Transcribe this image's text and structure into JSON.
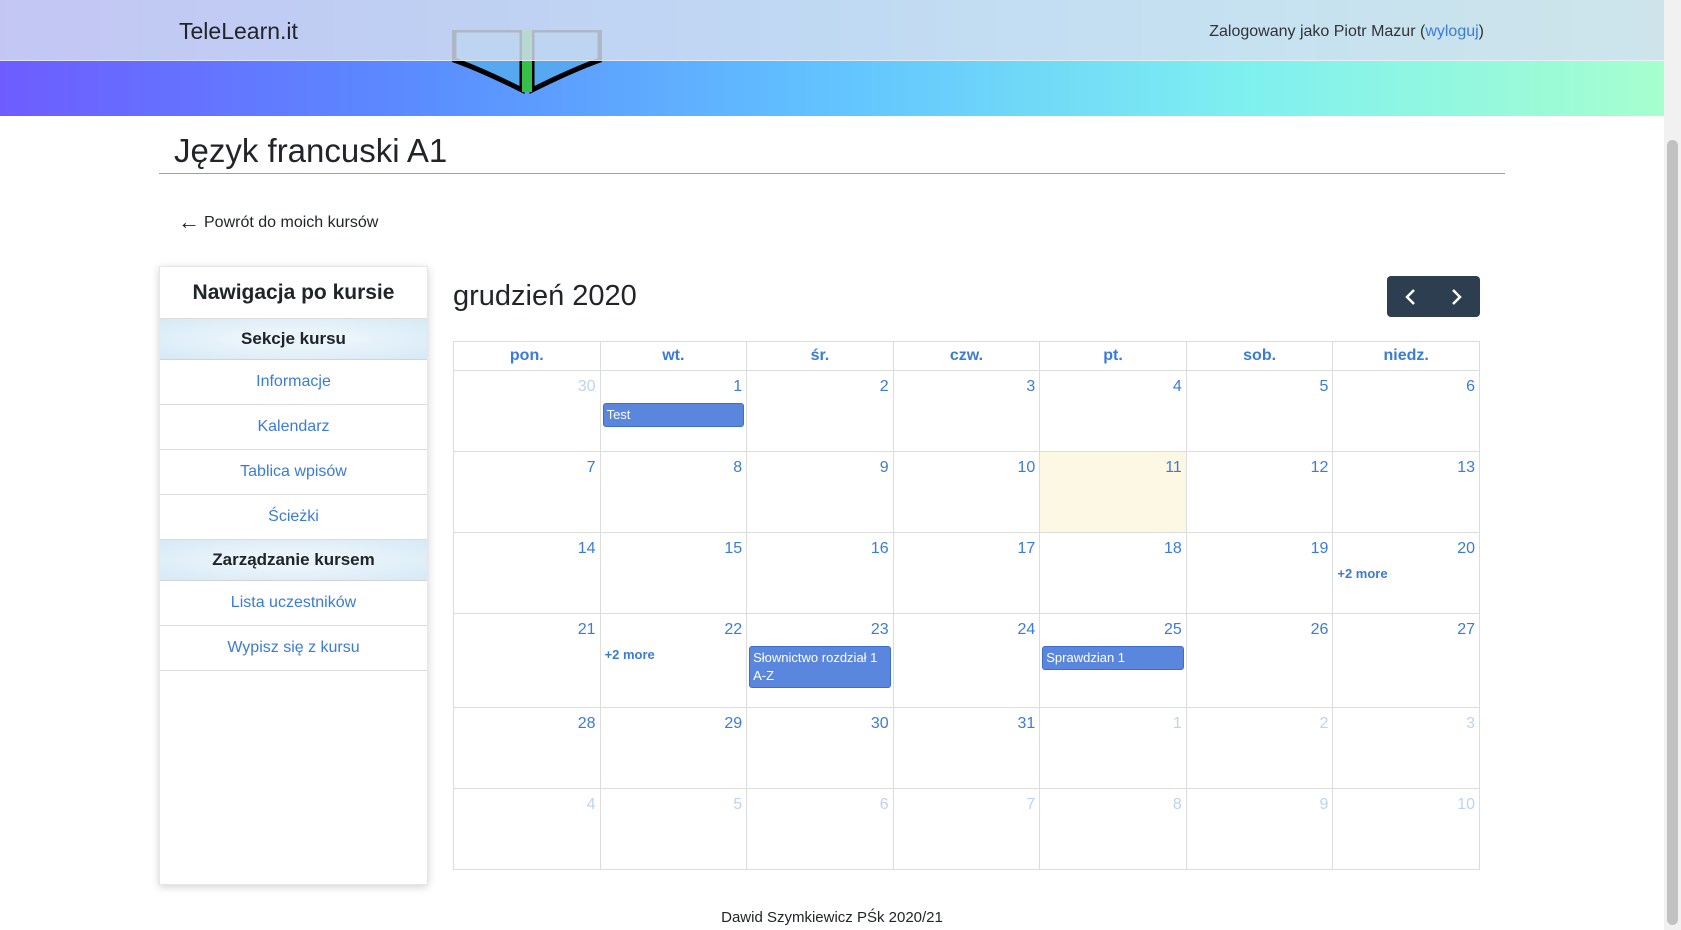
{
  "header": {
    "brand": "TeleLearn.it",
    "user_prefix": "Zalogowany jako Piotr Mazur (",
    "logout_label": "wyloguj",
    "user_suffix": ")"
  },
  "course": {
    "title": "Język francuski A1",
    "back_label": "Powrót do moich kursów"
  },
  "sidebar": {
    "title": "Nawigacja po kursie",
    "sections": [
      {
        "label": "Sekcje kursu",
        "items": [
          "Informacje",
          "Kalendarz",
          "Tablica wpisów",
          "Ścieżki"
        ]
      },
      {
        "label": "Zarządzanie kursem",
        "items": [
          "Lista uczestników",
          "Wypisz się z kursu"
        ]
      }
    ]
  },
  "calendar": {
    "title": "grudzień 2020",
    "weekdays": [
      "pon.",
      "wt.",
      "śr.",
      "czw.",
      "pt.",
      "sob.",
      "niedz."
    ],
    "weeks": [
      [
        {
          "day": "30",
          "other": true
        },
        {
          "day": "1",
          "events": [
            "Test"
          ]
        },
        {
          "day": "2"
        },
        {
          "day": "3"
        },
        {
          "day": "4"
        },
        {
          "day": "5"
        },
        {
          "day": "6"
        }
      ],
      [
        {
          "day": "7"
        },
        {
          "day": "8"
        },
        {
          "day": "9"
        },
        {
          "day": "10"
        },
        {
          "day": "11",
          "today": true
        },
        {
          "day": "12"
        },
        {
          "day": "13"
        }
      ],
      [
        {
          "day": "14"
        },
        {
          "day": "15"
        },
        {
          "day": "16"
        },
        {
          "day": "17"
        },
        {
          "day": "18"
        },
        {
          "day": "19"
        },
        {
          "day": "20",
          "more": "+2 more"
        }
      ],
      [
        {
          "day": "21"
        },
        {
          "day": "22",
          "more": "+2 more"
        },
        {
          "day": "23",
          "events": [
            "Słownictwo rozdział 1 A-Z"
          ]
        },
        {
          "day": "24"
        },
        {
          "day": "25",
          "events": [
            "Sprawdzian 1"
          ]
        },
        {
          "day": "26"
        },
        {
          "day": "27"
        }
      ],
      [
        {
          "day": "28"
        },
        {
          "day": "29"
        },
        {
          "day": "30"
        },
        {
          "day": "31"
        },
        {
          "day": "1",
          "other": true
        },
        {
          "day": "2",
          "other": true
        },
        {
          "day": "3",
          "other": true
        }
      ],
      [
        {
          "day": "4",
          "other": true
        },
        {
          "day": "5",
          "other": true
        },
        {
          "day": "6",
          "other": true
        },
        {
          "day": "7",
          "other": true
        },
        {
          "day": "8",
          "other": true
        },
        {
          "day": "9",
          "other": true
        },
        {
          "day": "10",
          "other": true
        }
      ]
    ]
  },
  "footer": {
    "text": "Dawid Szymkiewicz PŚk 2020/21"
  },
  "icons": {
    "back": "arrow-left-icon",
    "prev": "chevron-left-icon",
    "next": "chevron-right-icon"
  },
  "colors": {
    "link": "#3b7bd8",
    "event": "#5a87dd",
    "today": "#fcf8e3",
    "nav_button": "#2c3e50"
  }
}
